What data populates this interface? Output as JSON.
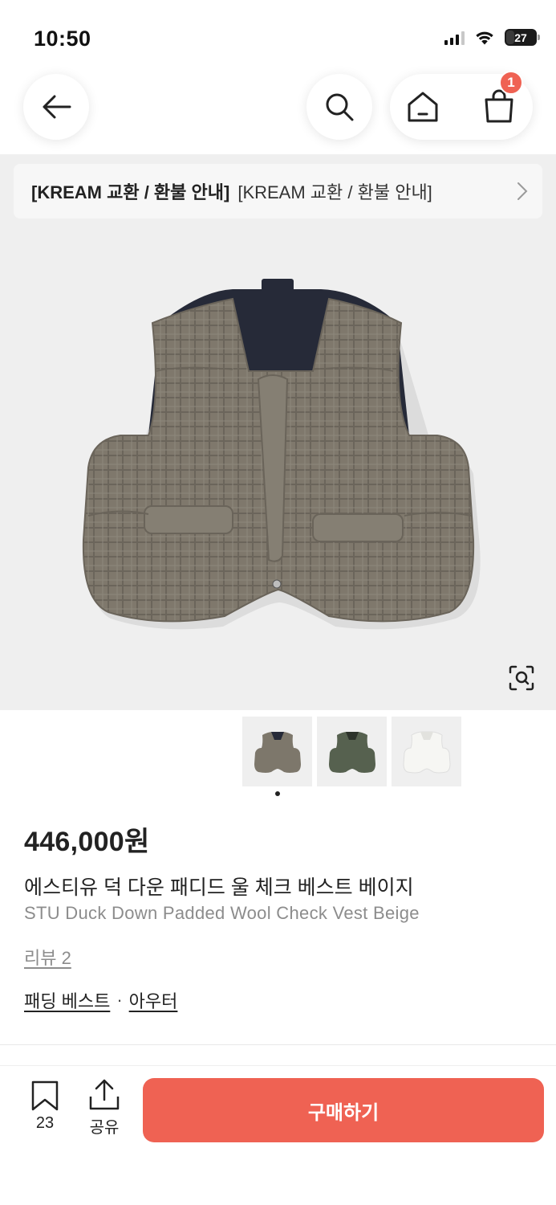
{
  "status_bar": {
    "time": "10:50",
    "battery": "27"
  },
  "nav": {
    "back_icon": "arrow-left-icon",
    "search_icon": "search-icon",
    "home_icon": "home-icon",
    "cart_icon": "shopping-bag-icon",
    "cart_count": "1"
  },
  "notice": {
    "title": "[KREAM 교환 / 환불 안내]",
    "text": "[KREAM 교환 / 환불 안내]"
  },
  "product": {
    "price": "446,000원",
    "name_ko": "에스티유 덕 다운 패디드 울 체크 베스트 베이지",
    "name_en": "STU Duck Down Padded Wool Check Vest Beige",
    "review": "리뷰 2",
    "categories": [
      "패딩 베스트",
      "아우터"
    ],
    "category_separator": "·",
    "thumbnails": [
      "beige",
      "green",
      "white"
    ],
    "thumbnail_colors": [
      "#7d776b",
      "#56614f",
      "#ecebe6"
    ]
  },
  "bottom": {
    "bookmark_count": "23",
    "share_label": "공유",
    "buy_label": "구매하기"
  },
  "colors": {
    "accent": "#ef6253"
  }
}
